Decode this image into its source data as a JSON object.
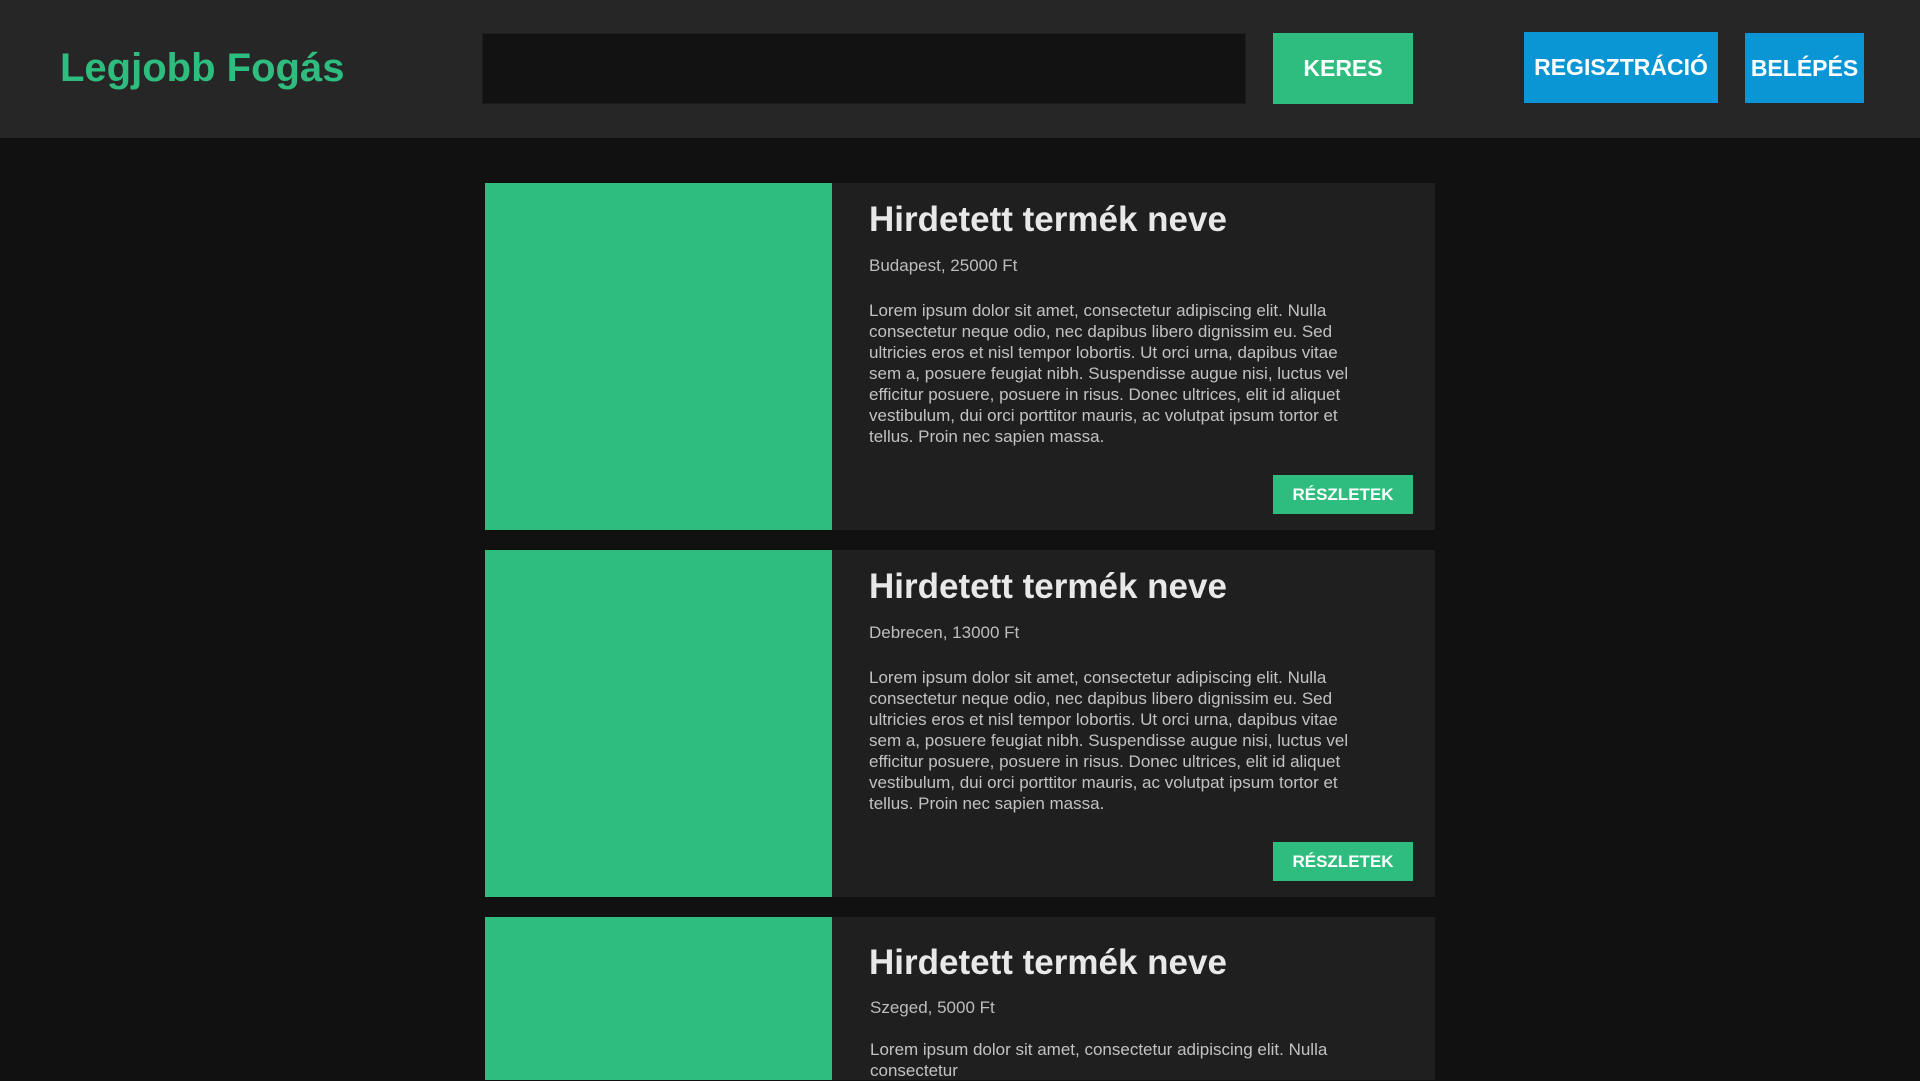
{
  "header": {
    "logo": "Legjobb Fogás",
    "search": {
      "value": "",
      "placeholder": ""
    },
    "search_label": "KERES",
    "register_label": "REGISZTRÁCIÓ",
    "login_label": "BELÉPÉS"
  },
  "colors": {
    "accent_green": "#2ebd7e",
    "accent_blue": "#0a95d4",
    "background": "#111111",
    "header_bg": "#262626",
    "card_bg": "#1f1f1f"
  },
  "listings": [
    {
      "title": "Hirdetett termék neve",
      "meta": "Budapest, 25000 Ft",
      "description": "Lorem ipsum dolor sit amet, consectetur adipiscing elit. Nulla consectetur neque odio, nec dapibus libero dignissim eu. Sed ultricies eros et nisl tempor lobortis. Ut orci urna, dapibus vitae sem a, posuere feugiat nibh. Suspendisse augue nisi, luctus vel efficitur posuere, posuere in risus. Donec ultrices, elit id aliquet vestibulum, dui orci porttitor mauris, ac volutpat ipsum tortor et tellus. Proin nec sapien massa.",
      "details_label": "RÉSZLETEK"
    },
    {
      "title": "Hirdetett termék neve",
      "meta": "Debrecen, 13000 Ft",
      "description": "Lorem ipsum dolor sit amet, consectetur adipiscing elit. Nulla consectetur neque odio, nec dapibus libero dignissim eu. Sed ultricies eros et nisl tempor lobortis. Ut orci urna, dapibus vitae sem a, posuere feugiat nibh. Suspendisse augue nisi, luctus vel efficitur posuere, posuere in risus. Donec ultrices, elit id aliquet vestibulum, dui orci porttitor mauris, ac volutpat ipsum tortor et tellus. Proin nec sapien massa.",
      "details_label": "RÉSZLETEK"
    },
    {
      "title": "Hirdetett termék neve",
      "meta": "Szeged, 5000 Ft",
      "description": "Lorem ipsum dolor sit amet, consectetur adipiscing elit. Nulla consectetur"
    }
  ]
}
